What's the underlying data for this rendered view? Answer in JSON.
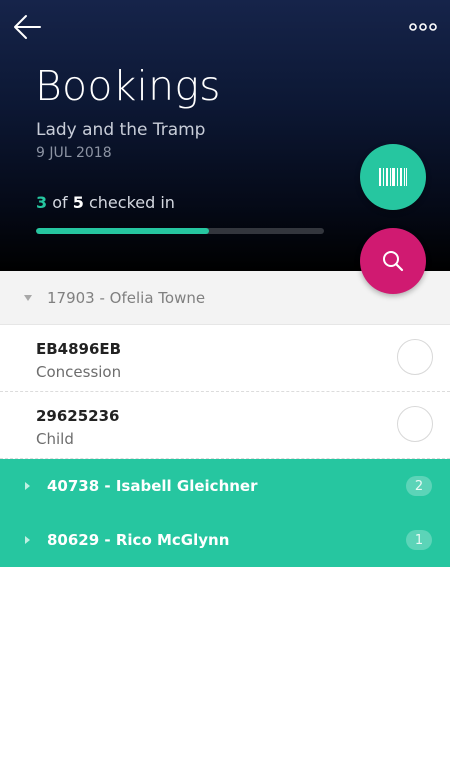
{
  "colors": {
    "accent_teal": "#26c6a0",
    "accent_magenta": "#d01a71",
    "header_dark": "#0c1733"
  },
  "header": {
    "back_icon": "arrow-left-icon",
    "more_icon": "more-horizontal-icon",
    "title": "Bookings",
    "show_name": "Lady and the Tramp",
    "show_date": "9 JUL 2018",
    "checked_in": "3",
    "of_word": "of",
    "total": "5",
    "checked_in_label": "checked in",
    "progress_fraction": 0.6
  },
  "actions": {
    "scan_icon": "barcode-icon",
    "search_icon": "search-icon"
  },
  "bookings": [
    {
      "label": "17903 - Ofelia Towne",
      "expanded": true,
      "tickets": [
        {
          "code": "EB4896EB",
          "type": "Concession"
        },
        {
          "code": "29625236",
          "type": "Child"
        }
      ]
    },
    {
      "label": "40738 - Isabell Gleichner",
      "expanded": false,
      "count": "2"
    },
    {
      "label": "80629 - Rico McGlynn",
      "expanded": false,
      "count": "1"
    }
  ]
}
